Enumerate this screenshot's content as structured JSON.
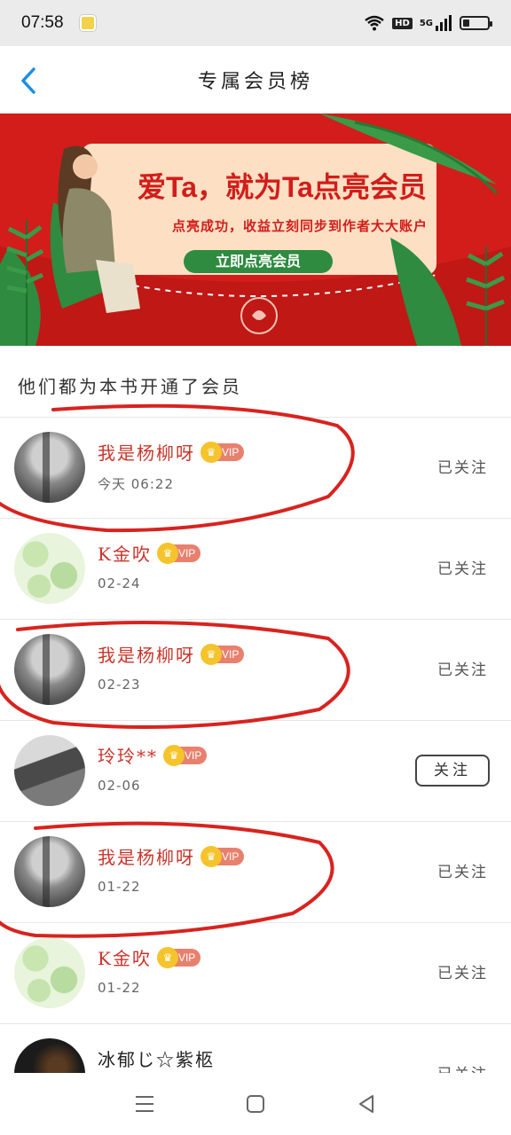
{
  "status_bar": {
    "time": "07:58",
    "hd": "HD",
    "net": "5G",
    "battery_level": 0.25
  },
  "header": {
    "title": "专属会员榜"
  },
  "banner": {
    "headline": "爱Ta，就为Ta点亮会员",
    "subtitle": "点亮成功，收益立刻同步到作者大大账户",
    "cta": "立即点亮会员",
    "colors": {
      "background": "#d21d1a",
      "card": "#fde0c4",
      "cta": "#2e8b3f"
    }
  },
  "section": {
    "title": "他们都为本书开通了会员"
  },
  "vip_label": "VIP",
  "members": [
    {
      "name": "我是杨柳呀",
      "date": "今天 06:22",
      "action": "已关注",
      "followed": true,
      "avatar": "cat-photo-avatar"
    },
    {
      "name": "K金吹",
      "date": "02-24",
      "action": "已关注",
      "followed": true,
      "avatar": "pear-pattern-avatar"
    },
    {
      "name": "我是杨柳呀",
      "date": "02-23",
      "action": "已关注",
      "followed": true,
      "avatar": "cat-photo-avatar"
    },
    {
      "name": "玲玲**",
      "date": "02-06",
      "action": "关注",
      "followed": false,
      "avatar": "girl-photo-avatar"
    },
    {
      "name": "我是杨柳呀",
      "date": "01-22",
      "action": "已关注",
      "followed": true,
      "avatar": "cat-photo-avatar"
    },
    {
      "name": "K金吹",
      "date": "01-22",
      "action": "已关注",
      "followed": true,
      "avatar": "pear-pattern-avatar"
    },
    {
      "name": "冰郁じ☆紫柩",
      "date": "",
      "action": "已关注",
      "followed": true,
      "avatar": "dark-photo-avatar"
    }
  ],
  "colors": {
    "accent_red": "#c8352a",
    "annotation_red": "#d8231f"
  }
}
